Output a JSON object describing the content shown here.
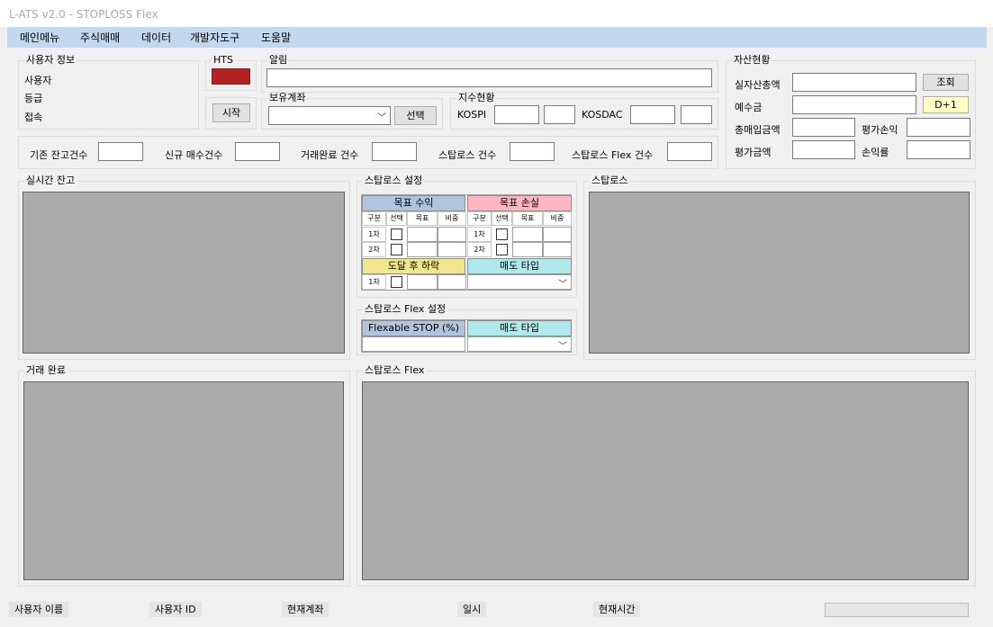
{
  "window": {
    "title": "L-ATS v2.0 - STOPLOSS Flex"
  },
  "menu": [
    "메인메뉴",
    "주식매매",
    "데이터",
    "개발자도구",
    "도움말"
  ],
  "user_info": {
    "title": "사용자 정보",
    "user": "사용자",
    "grade": "등급",
    "connect": "접속"
  },
  "hts": {
    "title": "HTS",
    "start_button": "시작",
    "indicator_color": "#b22222"
  },
  "notice": {
    "title": "알림"
  },
  "account": {
    "title": "보유계좌",
    "select_button": "선택"
  },
  "index": {
    "title": "지수현황",
    "kospi": "KOSPI",
    "kosdac": "KOSDAC"
  },
  "assets": {
    "title": "자산현황",
    "real_total": "실자산총액",
    "deposit": "예수금",
    "total_buy": "총매입금액",
    "eval_pl": "평가손익",
    "eval_amount": "평가금액",
    "pl_rate": "손익률",
    "query_button": "조회",
    "d1_button": "D+1"
  },
  "counts": {
    "existing": "기존 잔고건수",
    "new_buy": "신규 매수건수",
    "completed": "거래완료 건수",
    "stoploss": "스탑로스 건수",
    "stoploss_flex": "스탑로스 Flex 건수"
  },
  "panels": {
    "realtime": "실시간 잔고",
    "stoploss_setting": "스탑로스 설정",
    "stoploss": "스탑로스",
    "flex_setting": "스탑로스 Flex 설정",
    "completed": "거래 완료",
    "stoploss_flex": "스탑로스 Flex"
  },
  "sl_table": {
    "target_profit": "목표 수익",
    "target_loss": "목표 손실",
    "reach_drop": "도달 후 하락",
    "sell_type": "매도 타입",
    "col_gubun": "구분",
    "col_select": "선택",
    "col_target": "목표",
    "col_ratio": "비중",
    "row1": "1차",
    "row2": "2차"
  },
  "flex_table": {
    "flexable_stop": "Flexable STOP (%)",
    "sell_type": "매도 타입"
  },
  "status": {
    "user_name": "사용자 이름",
    "user_id": "사용자 ID",
    "current_account": "현재계좌",
    "date": "일시",
    "current_time": "현재시간"
  }
}
